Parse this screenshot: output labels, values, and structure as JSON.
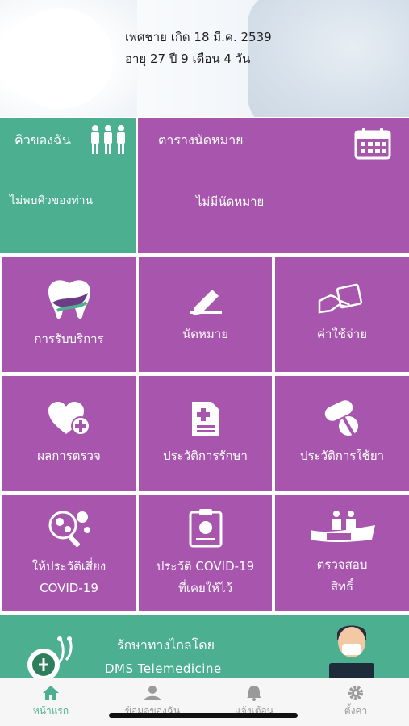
{
  "profile": {
    "line1": "เพศชาย เกิด 18 มี.ค. 2539",
    "line2": "อายุ 27 ปี 9 เดือน 4 วัน"
  },
  "queue": {
    "title": "คิวของฉัน",
    "empty": "ไม่พบคิวของท่าน",
    "icon": "people-queue-icon"
  },
  "appointments": {
    "title": "ตารางนัดหมาย",
    "empty": "ไม่มีนัดหมาย",
    "icon": "calendar-icon"
  },
  "menu": [
    {
      "label": "การรับบริการ",
      "icon": "tooth-icon"
    },
    {
      "label": "นัดหมาย",
      "icon": "pencil-edit-icon"
    },
    {
      "label": "ค่าใช้จ่าย",
      "icon": "hand-money-icon"
    },
    {
      "label": "ผลการตรวจ",
      "icon": "heart-plus-icon"
    },
    {
      "label": "ประวัติการรักษา",
      "icon": "medical-document-icon"
    },
    {
      "label": "ประวัติการใช้ยา",
      "icon": "pills-icon"
    },
    {
      "label1": "ให้ประวัติเสี่ยง",
      "label2": "COVID-19",
      "icon": "virus-magnifier-icon"
    },
    {
      "label1": "ประวัติ COVID-19",
      "label2": "ที่เคยให้ไว้",
      "icon": "virus-clipboard-icon"
    },
    {
      "label1": "ตรวจสอบ",
      "label2": "สิทธิ์",
      "icon": "nhso-logo-icon"
    }
  ],
  "banner": {
    "line1": "รักษาทางไกลโดย",
    "line2": "DMS Telemedicine"
  },
  "tabs": [
    {
      "label": "หน้าแรก",
      "icon": "home-icon",
      "active": true
    },
    {
      "label": "ข้อมูลของฉัน",
      "icon": "user-icon",
      "active": false
    },
    {
      "label": "แจ้งเตือน",
      "icon": "bell-icon",
      "active": false
    },
    {
      "label": "ตั้งค่า",
      "icon": "gear-icon",
      "active": false
    }
  ],
  "colors": {
    "purple": "#a855ad",
    "green": "#4caf8f",
    "tab_active": "#4caf8f",
    "tab_inactive": "#9a9a9a"
  }
}
